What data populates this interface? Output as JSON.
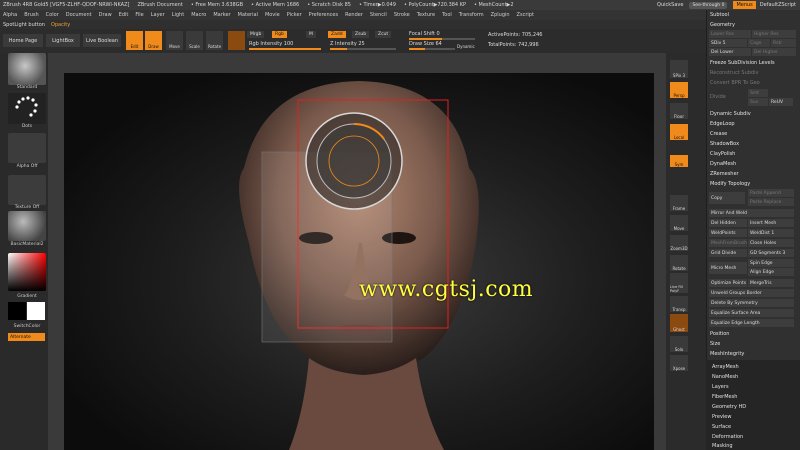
{
  "title_bar": {
    "app": "ZBrush 4R8 Gold5 [VGF5-ZLHF-QDOF-NRWI-NKAZ]",
    "document": "ZBrush Document",
    "free_mem": "• Free Mem 3.638GB",
    "active_mem": "• Active Mem 1686",
    "scratch": "• Scratch Disk 85",
    "timer": "• Timer▶0.049",
    "poly_count": "• PolyCount▶720.384 KP",
    "mesh_count": "• MeshCount▶2",
    "quicksave": "QuickSave",
    "see_through": "See-through  0",
    "menus": "Menus",
    "default_script": "DefaultZScript"
  },
  "menu_bar": [
    "Alpha",
    "Brush",
    "Color",
    "Document",
    "Draw",
    "Edit",
    "File",
    "Layer",
    "Light",
    "Macro",
    "Marker",
    "Material",
    "Movie",
    "Picker",
    "Preferences",
    "Render",
    "Stencil",
    "Stroke",
    "Texture",
    "Tool",
    "Transform",
    "Zplugin",
    "Zscript"
  ],
  "sub_bar": {
    "label": "SpotLight button",
    "value": "Opacity"
  },
  "toolbar": {
    "home_page": "Home Page",
    "lightbox": "LightBox",
    "live_boolean": "Live Boolean",
    "edit": "Edit",
    "draw": "Draw",
    "move": "Move",
    "scale": "Scale",
    "rotate": "Rotate",
    "mrgb": "Mrgb",
    "rgb": "Rgb",
    "m": "M",
    "zadd": "Zadd",
    "zsub": "Zsub",
    "zcut": "Zcut",
    "rgb_intensity": "Rgb Intensity 100",
    "z_intensity": "Z Intensity 25",
    "focal_shift": "Focal Shift 0",
    "draw_size": "Draw Size 64",
    "dynamic": "Dynamic",
    "active_points": "ActivePoints: 705,246",
    "total_points": "TotalPoints: 742,996"
  },
  "left_panel": {
    "brush": "Standard",
    "stroke": "Dots",
    "alpha": "Alpha Off",
    "texture": "Texture Off",
    "material": "BasicMaterial2",
    "gradient": "Gradient",
    "switch_color": "SwitchColor",
    "alternate": "Alternate"
  },
  "right_shelf": [
    "SPix 3",
    "Persp",
    "Floor",
    "Local",
    "Sym",
    "Frame",
    "Move",
    "Zoom3D",
    "Rotate",
    "Line Fill PolyF",
    "Transp",
    "Ghost",
    "Solo",
    "Xpose"
  ],
  "right_panel": {
    "items": [
      {
        "label": "Subtool",
        "dim": false
      },
      {
        "label": "Geometry",
        "dim": false
      },
      {
        "label": "Lower Res",
        "dim": true
      },
      {
        "label": "Higher Res",
        "dim": true
      },
      {
        "label": "SDiv 5",
        "dim": false
      },
      {
        "label": "Cage",
        "dim": true
      },
      {
        "label": "Rstr",
        "dim": true
      },
      {
        "label": "Del Lower",
        "dim": false
      },
      {
        "label": "Del Higher",
        "dim": true
      },
      {
        "label": "Freeze SubDivision Levels",
        "dim": false
      },
      {
        "label": "Reconstruct Subdiv",
        "dim": true
      },
      {
        "label": "Convert BPR To Geo",
        "dim": true
      },
      {
        "label": "Divide",
        "dim": true
      },
      {
        "label": "Smt",
        "dim": true
      },
      {
        "label": "Suv",
        "dim": true
      },
      {
        "label": "ReUV",
        "dim": false
      },
      {
        "label": "Dynamic Subdiv",
        "dim": false
      },
      {
        "label": "EdgeLoop",
        "dim": false
      },
      {
        "label": "Crease",
        "dim": false
      },
      {
        "label": "ShadowBox",
        "dim": false
      },
      {
        "label": "ClayPolish",
        "dim": false
      },
      {
        "label": "DynaMesh",
        "dim": false
      },
      {
        "label": "ZRemesher",
        "dim": false
      },
      {
        "label": "Modify Topology",
        "dim": false
      },
      {
        "label": "Copy",
        "dim": false
      },
      {
        "label": "Paste Append",
        "dim": true
      },
      {
        "label": "Paste Replace",
        "dim": true
      },
      {
        "label": "Mirror And Weld",
        "dim": false
      },
      {
        "label": "Del Hidden",
        "dim": false
      },
      {
        "label": "Insert Mesh",
        "dim": false
      },
      {
        "label": "WeldPoints",
        "dim": false
      },
      {
        "label": "WeldDist 1",
        "dim": false
      },
      {
        "label": "MeshFromBrush",
        "dim": true
      },
      {
        "label": "Close Holes",
        "dim": false
      },
      {
        "label": "Grid Divide",
        "dim": false
      },
      {
        "label": "GD Segments 3",
        "dim": false
      },
      {
        "label": "Micro Mesh",
        "dim": false
      },
      {
        "label": "Spin Edge",
        "dim": false
      },
      {
        "label": "Align Edge",
        "dim": false
      },
      {
        "label": "Optimize Points",
        "dim": false
      },
      {
        "label": "MergeTris",
        "dim": false
      },
      {
        "label": "Unweld Groups Border",
        "dim": false
      },
      {
        "label": "Delete By Symmetry",
        "dim": false
      },
      {
        "label": "Equalize Surface Area",
        "dim": false
      },
      {
        "label": "Equalize Edge Length",
        "dim": false
      },
      {
        "label": "Position",
        "dim": false
      },
      {
        "label": "Size",
        "dim": false
      },
      {
        "label": "MeshIntegrity",
        "dim": false
      }
    ],
    "lower": [
      "ArrayMesh",
      "NanoMesh",
      "Layers",
      "FiberMesh",
      "Geometry HD",
      "Preview",
      "Surface",
      "Deformation",
      "Masking"
    ]
  },
  "watermark": "www.cgtsj.com",
  "colors": {
    "accent": "#f08a1a",
    "canvas": "#101010",
    "panel": "#303030"
  }
}
